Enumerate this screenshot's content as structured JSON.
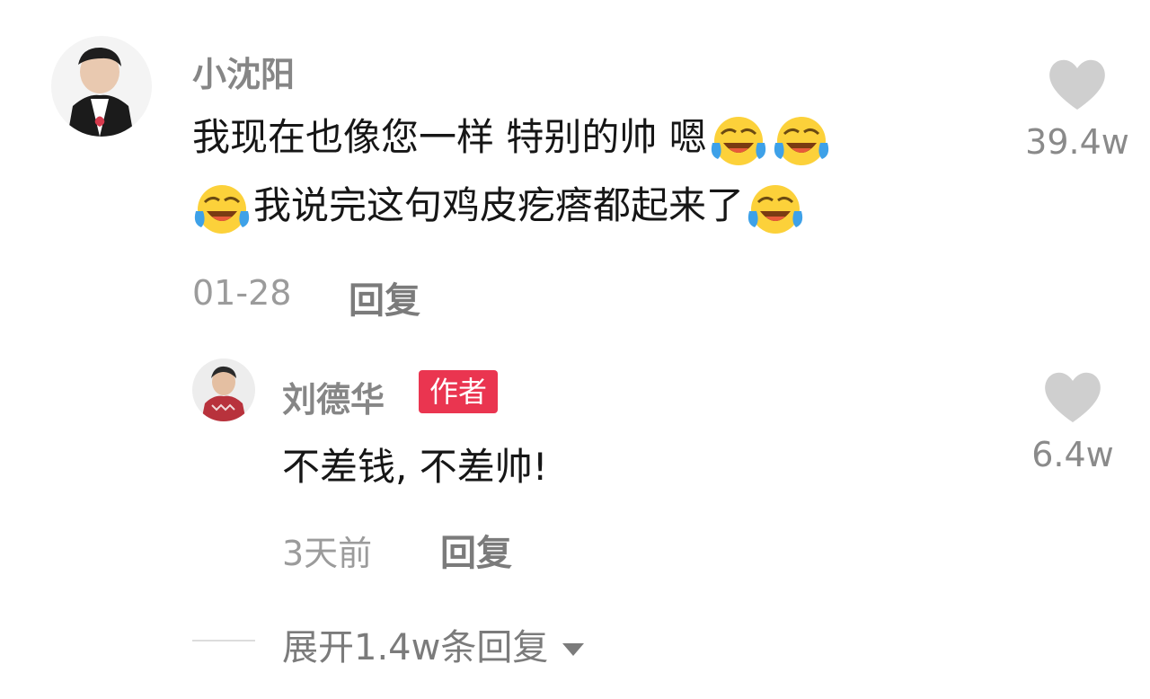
{
  "comment": {
    "username": "小沈阳",
    "text_line1": "我现在也像您一样 特别的帅 嗯",
    "text_line2": "我说完这句鸡皮疙瘩都起来了",
    "time": "01-28",
    "reply_label": "回复",
    "likes": "39.4w",
    "avatar_icon": "avatar-photo-icon",
    "emoji_icon": "laughing-crying-emoji-icon"
  },
  "reply": {
    "username": "刘德华",
    "badge": "作者",
    "text": "不差钱, 不差帅!",
    "time": "3天前",
    "reply_label": "回复",
    "likes": "6.4w",
    "avatar_icon": "avatar-photo-icon"
  },
  "expand": {
    "label": "展开1.4w条回复",
    "icon": "triangle-down-icon"
  },
  "colors": {
    "badge": "#ea3550",
    "heart": "#cfcfcf",
    "username": "#868686",
    "body_text": "#161616",
    "meta": "#9b9b9b"
  }
}
